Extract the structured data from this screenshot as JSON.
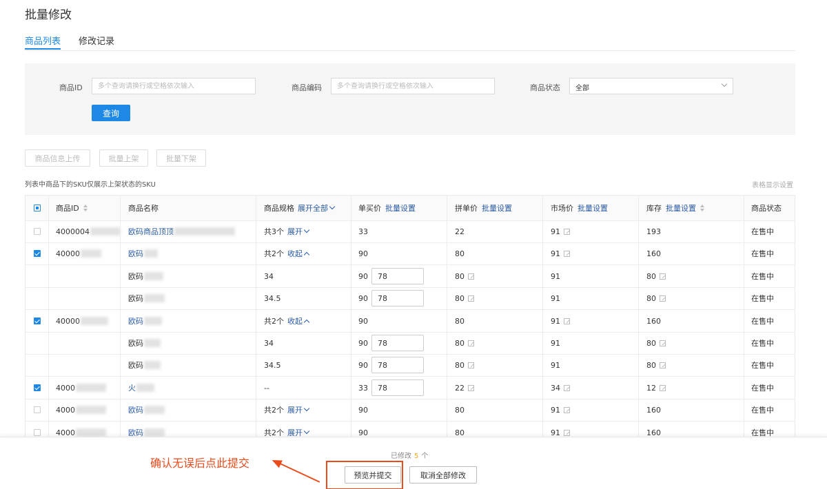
{
  "page": {
    "title": "批量修改"
  },
  "tabs": [
    {
      "label": "商品列表",
      "active": true
    },
    {
      "label": "修改记录",
      "active": false
    }
  ],
  "filter": {
    "id_label": "商品ID",
    "id_placeholder": "多个查询请换行或空格依次输入",
    "code_label": "商品编码",
    "code_placeholder": "多个查询请换行或空格依次输入",
    "status_label": "商品状态",
    "status_value": "全部",
    "query_button": "查询"
  },
  "actions": {
    "upload": "商品信息上传",
    "shelve": "批量上架",
    "unshelve": "批量下架"
  },
  "hint": "列表中商品下的SKU仅展示上架状态的SKU",
  "table_setting": "表格显示设置",
  "table": {
    "headers": {
      "id": "商品ID",
      "name": "商品名称",
      "spec": "商品规格",
      "spec_action": "展开全部",
      "unit_price": "单买价",
      "group_price": "拼单价",
      "market_price": "市场价",
      "stock": "库存",
      "batch_set": "批量设置",
      "status": "商品状态"
    },
    "rows": [
      {
        "id": "4000004",
        "name": "欧码商品顶顶",
        "spec": "共3个",
        "spec_action": "展开",
        "unit": "33",
        "unit_input": "",
        "group": "22",
        "group_edit": false,
        "market": "91",
        "market_edit": true,
        "stock": "193",
        "stock_edit": false,
        "status": "在售中",
        "checked": false
      },
      {
        "id": "40000",
        "name": "欧码",
        "spec": "共2个",
        "spec_action": "收起",
        "unit": "90",
        "unit_input": "",
        "group": "80",
        "group_edit": false,
        "market": "91",
        "market_edit": true,
        "stock": "160",
        "stock_edit": false,
        "status": "在售中",
        "checked": true
      },
      {
        "id": "",
        "name": "欧码",
        "spec": "34",
        "spec_action": "",
        "unit": "90",
        "unit_input": "78",
        "group": "80",
        "group_edit": true,
        "market": "91",
        "market_edit": false,
        "stock": "80",
        "stock_edit": true,
        "status": "在售中",
        "checked": false,
        "sub": true
      },
      {
        "id": "",
        "name": "欧码",
        "spec": "34.5",
        "spec_action": "",
        "unit": "90",
        "unit_input": "78",
        "group": "80",
        "group_edit": true,
        "market": "91",
        "market_edit": false,
        "stock": "80",
        "stock_edit": true,
        "status": "在售中",
        "checked": false,
        "sub": true
      },
      {
        "id": "40000",
        "name": "欧码",
        "spec": "共2个",
        "spec_action": "收起",
        "unit": "90",
        "unit_input": "",
        "group": "80",
        "group_edit": false,
        "market": "91",
        "market_edit": true,
        "stock": "160",
        "stock_edit": false,
        "status": "在售中",
        "checked": true
      },
      {
        "id": "",
        "name": "欧码",
        "spec": "34",
        "spec_action": "",
        "unit": "90",
        "unit_input": "78",
        "group": "80",
        "group_edit": true,
        "market": "91",
        "market_edit": false,
        "stock": "80",
        "stock_edit": true,
        "status": "在售中",
        "checked": false,
        "sub": true
      },
      {
        "id": "",
        "name": "欧码",
        "spec": "34.5",
        "spec_action": "",
        "unit": "90",
        "unit_input": "78",
        "group": "80",
        "group_edit": true,
        "market": "91",
        "market_edit": false,
        "stock": "80",
        "stock_edit": true,
        "status": "在售中",
        "checked": false,
        "sub": true
      },
      {
        "id": "4000",
        "name": "火",
        "spec": "--",
        "spec_action": "",
        "unit": "33",
        "unit_input": "78",
        "group": "22",
        "group_edit": true,
        "market": "34",
        "market_edit": true,
        "stock": "12",
        "stock_edit": true,
        "status": "在售中",
        "checked": true
      },
      {
        "id": "4000",
        "name": "欧码",
        "spec": "共2个",
        "spec_action": "展开",
        "unit": "90",
        "unit_input": "",
        "group": "80",
        "group_edit": false,
        "market": "91",
        "market_edit": true,
        "stock": "160",
        "stock_edit": false,
        "status": "在售中",
        "checked": false
      },
      {
        "id": "4000",
        "name": "欧码",
        "spec": "共2个",
        "spec_action": "展开",
        "unit": "90",
        "unit_input": "",
        "group": "80",
        "group_edit": false,
        "market": "91",
        "market_edit": true,
        "stock": "160",
        "stock_edit": false,
        "status": "在售中",
        "checked": false
      }
    ]
  },
  "footer": {
    "modified_prefix": "已修改",
    "modified_count": "5",
    "modified_suffix": "个",
    "preview_button": "预览并提交",
    "cancel_button": "取消全部修改",
    "annotation": "确认无误后点此提交"
  },
  "colors": {
    "accent": "#1e88e5",
    "link": "#2a5ba8",
    "annotation": "#e84c1c",
    "count": "#f5a623"
  }
}
